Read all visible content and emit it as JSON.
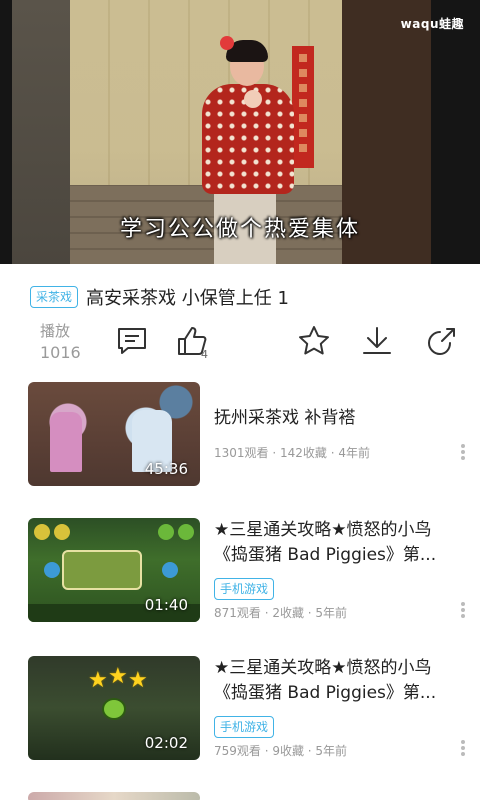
{
  "player": {
    "subtitle": "学习公公做个热爱集体",
    "watermark": "waqu蛙趣"
  },
  "video": {
    "tag": "采茶戏",
    "title": "高安采茶戏 小保管上任 1"
  },
  "actions": {
    "play_label": "播放",
    "play_count": "1016",
    "like_count": "4"
  },
  "related": [
    {
      "title": "抚州采茶戏 补背褡",
      "duration": "45:36",
      "tag": "",
      "meta": "1301观看 · 142收藏 · 4年前"
    },
    {
      "title": "★三星通关攻略★愤怒的小鸟《捣蛋猪 Bad Piggies》第...",
      "duration": "01:40",
      "tag": "手机游戏",
      "meta": "871观看 · 2收藏 · 5年前"
    },
    {
      "title": "★三星通关攻略★愤怒的小鸟《捣蛋猪 Bad Piggies》第...",
      "duration": "02:02",
      "tag": "手机游戏",
      "meta": "759观看 · 9收藏 · 5年前"
    }
  ],
  "icons": {
    "comment": "comment-icon",
    "like": "thumbs-up-icon",
    "favorite": "star-icon",
    "download": "download-icon",
    "share": "share-icon",
    "more": "more-vertical-icon"
  },
  "colors": {
    "accent": "#41b3e6",
    "meta": "#999999"
  }
}
